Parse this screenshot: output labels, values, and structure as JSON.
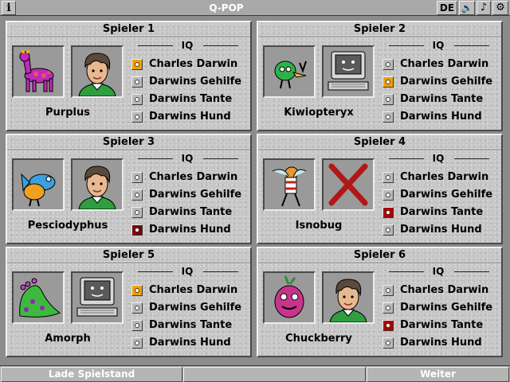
{
  "app": {
    "info_label": "i",
    "title": "Q-POP",
    "language": "DE",
    "speaker_glyph": "🔈",
    "note_glyph": "♪",
    "gear_glyph": "⚙"
  },
  "iq_label": "IQ",
  "players": [
    {
      "title": "Spieler 1",
      "name": "Purplus",
      "avatar": "purplus-creature",
      "controller": "human-boy",
      "options": [
        "Charles Darwin",
        "Darwins Gehilfe",
        "Darwins Tante",
        "Darwins Hund"
      ],
      "selected": 0,
      "selected_color": "#f0a000"
    },
    {
      "title": "Spieler 2",
      "name": "Kiwiopteryx",
      "avatar": "kiwiopteryx-creature",
      "controller": "computer",
      "options": [
        "Charles Darwin",
        "Darwins Gehilfe",
        "Darwins Tante",
        "Darwins Hund"
      ],
      "selected": 1,
      "selected_color": "#f0a000"
    },
    {
      "title": "Spieler 3",
      "name": "Pesciodyphus",
      "avatar": "pesciodyphus-creature",
      "controller": "human-boy",
      "options": [
        "Charles Darwin",
        "Darwins Gehilfe",
        "Darwins Tante",
        "Darwins Hund"
      ],
      "selected": 3,
      "selected_color": "#8b0000"
    },
    {
      "title": "Spieler 4",
      "name": "Isnobug",
      "avatar": "isnobug-creature",
      "controller": "none-cross",
      "options": [
        "Charles Darwin",
        "Darwins Gehilfe",
        "Darwins Tante",
        "Darwins Hund"
      ],
      "selected": 2,
      "selected_color": "#c00000"
    },
    {
      "title": "Spieler 5",
      "name": "Amorph",
      "avatar": "amorph-creature",
      "controller": "computer",
      "options": [
        "Charles Darwin",
        "Darwins Gehilfe",
        "Darwins Tante",
        "Darwins Hund"
      ],
      "selected": 0,
      "selected_color": "#f0a000"
    },
    {
      "title": "Spieler 6",
      "name": "Chuckberry",
      "avatar": "chuckberry-creature",
      "controller": "human-boy",
      "options": [
        "Charles Darwin",
        "Darwins Gehilfe",
        "Darwins Tante",
        "Darwins Hund"
      ],
      "selected": 2,
      "selected_color": "#c00000"
    }
  ],
  "footer": {
    "load_label": "Lade Spielstand",
    "middle_label": "",
    "next_label": "Weiter"
  }
}
